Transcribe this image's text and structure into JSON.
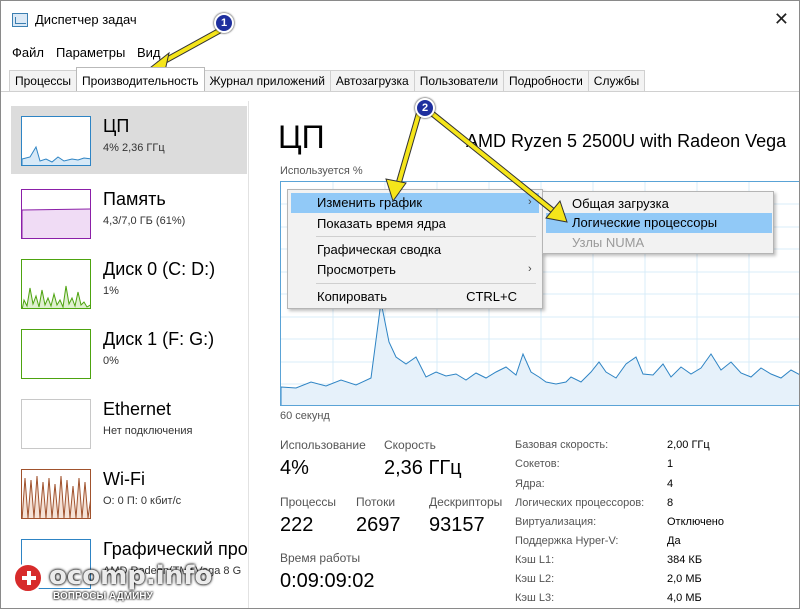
{
  "window": {
    "title": "Диспетчер задач",
    "close": "✕"
  },
  "menu": [
    "Файл",
    "Параметры",
    "Вид"
  ],
  "tabs": [
    "Процессы",
    "Производительность",
    "Журнал приложений",
    "Автозагрузка",
    "Пользователи",
    "Подробности",
    "Службы"
  ],
  "active_tab": "Производительность",
  "sidebar": {
    "items": [
      {
        "name": "ЦП",
        "sub": "4%  2,36 ГГц",
        "selected": true
      },
      {
        "name": "Память",
        "sub": "4,3/7,0 ГБ (61%)"
      },
      {
        "name": "Диск 0 (C: D:)",
        "sub": "1%"
      },
      {
        "name": "Диск 1 (F: G:)",
        "sub": "0%"
      },
      {
        "name": "Ethernet",
        "sub": "Нет подключения"
      },
      {
        "name": "Wi-Fi",
        "sub": "О: 0 П: 0 кбит/с"
      },
      {
        "name": "Графический про",
        "sub": "AMD Radeon(TM) Vega 8 G"
      }
    ],
    "colors": {
      "cpu": "#2e84c4",
      "memory": "#8b1fa8",
      "disk": "#4da30f",
      "wifi": "#a0522d"
    }
  },
  "main": {
    "title": "ЦП",
    "model": "AMD Ryzen 5 2500U with Radeon Vega",
    "usage_label": "Используется %",
    "seconds_label": "60 секунд",
    "stats": {
      "usage_label": "Использование",
      "usage_value": "4%",
      "speed_label": "Скорость",
      "speed_value": "2,36 ГГц",
      "processes_label": "Процессы",
      "processes_value": "222",
      "threads_label": "Потоки",
      "threads_value": "2697",
      "handles_label": "Дескрипторы",
      "handles_value": "93157",
      "uptime_label": "Время работы",
      "uptime_value": "0:09:09:02"
    },
    "specs": [
      {
        "label": "Базовая скорость:",
        "value": "2,00 ГГц"
      },
      {
        "label": "Сокетов:",
        "value": "1"
      },
      {
        "label": "Ядра:",
        "value": "4"
      },
      {
        "label": "Логических процессоров:",
        "value": "8"
      },
      {
        "label": "Виртуализация:",
        "value": "Отключено"
      },
      {
        "label": "Поддержка Hyper-V:",
        "value": "Да"
      },
      {
        "label": "Кэш L1:",
        "value": "384 КБ"
      },
      {
        "label": "Кэш L2:",
        "value": "2,0 МБ"
      },
      {
        "label": "Кэш L3:",
        "value": "4,0 МБ"
      }
    ]
  },
  "context_menu": {
    "items": [
      {
        "label": "Изменить график",
        "highlighted": true,
        "submenu": true
      },
      {
        "label": "Показать время ядра"
      },
      {
        "label": "Графическая сводка"
      },
      {
        "label": "Просмотреть",
        "submenu": true
      },
      {
        "label": "Копировать",
        "shortcut": "CTRL+C"
      }
    ],
    "submenu": [
      {
        "label": "Общая загрузка"
      },
      {
        "label": "Логические процессоры",
        "highlighted": true
      },
      {
        "label": "Узлы NUMA",
        "disabled": true
      }
    ]
  },
  "annotations": {
    "badge1": "1",
    "badge2": "2",
    "arrow_color": "#f5e51a"
  },
  "watermark": {
    "text": "ocomp.info",
    "sub": "ВОПРОСЫ АДМИНУ"
  }
}
